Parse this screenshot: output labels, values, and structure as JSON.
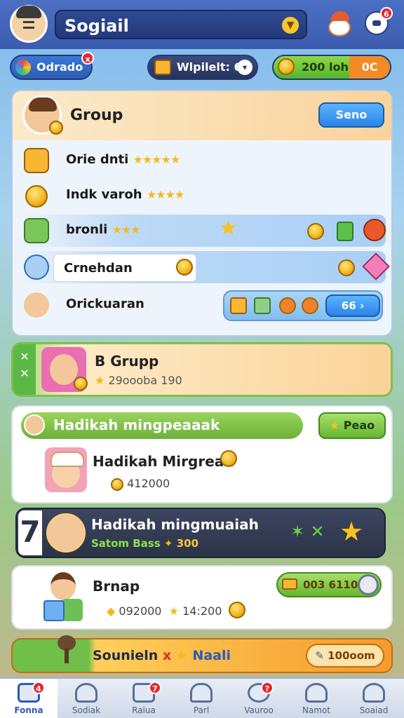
{
  "header": {
    "title": "Sogiail",
    "chat_badge": "6"
  },
  "resources": {
    "left_label": "Odrado",
    "left_badge": "x",
    "mid_label": "Wlpilelt: 60",
    "right_value": "200 lohi",
    "right_sub": "0C"
  },
  "group_panel": {
    "title": "Group",
    "action": "Seno",
    "rows": [
      {
        "name": "Orie dnti",
        "stars": "★★★★★"
      },
      {
        "name": "Indk varoh",
        "stars": "★★★★"
      },
      {
        "name": "bronli",
        "stars": "★★★"
      },
      {
        "name": "Crnehdan",
        "stars": ""
      },
      {
        "name": "Orickuaran",
        "stars": ""
      }
    ],
    "row5_button": "66"
  },
  "b_group": {
    "side_letters": "B\nX",
    "title": "B Grupp",
    "subtitle": "29oooba 190"
  },
  "hadikah": {
    "banner": "Hadikah mingpeaaak",
    "button": "Peao",
    "name": "Hadikah Mirgrean",
    "value": "412000"
  },
  "dark_row": {
    "rank": "7",
    "title": "Hadikah mingmuaiah",
    "sub_label": "Satom Bass",
    "sub_value": "300"
  },
  "brnap": {
    "title": "Brnap",
    "value1": "092000",
    "value2": "14:200",
    "pill_value": "003 6110"
  },
  "bottom_banner": {
    "text_main": "Sounieln",
    "text_x": "x",
    "text_end": "Naali",
    "button": "100oom"
  },
  "nav": [
    {
      "label": "Fonna",
      "icon": "home-icon",
      "badge": "4"
    },
    {
      "label": "Sodiak",
      "icon": "star-icon",
      "badge": ""
    },
    {
      "label": "Raiua",
      "icon": "calendar-icon",
      "badge": "7"
    },
    {
      "label": "Parl",
      "icon": "house-icon",
      "badge": ""
    },
    {
      "label": "Vauroo",
      "icon": "chat-icon",
      "badge": "?"
    },
    {
      "label": "Namot",
      "icon": "person-icon",
      "badge": ""
    },
    {
      "label": "Soaiad",
      "icon": "profile-icon",
      "badge": ""
    }
  ],
  "colors": {
    "accent_blue": "#2a5cb5",
    "accent_green": "#67b532",
    "accent_orange": "#f59a2b",
    "badge_red": "#e3282f",
    "star_gold": "#f6b81a"
  }
}
